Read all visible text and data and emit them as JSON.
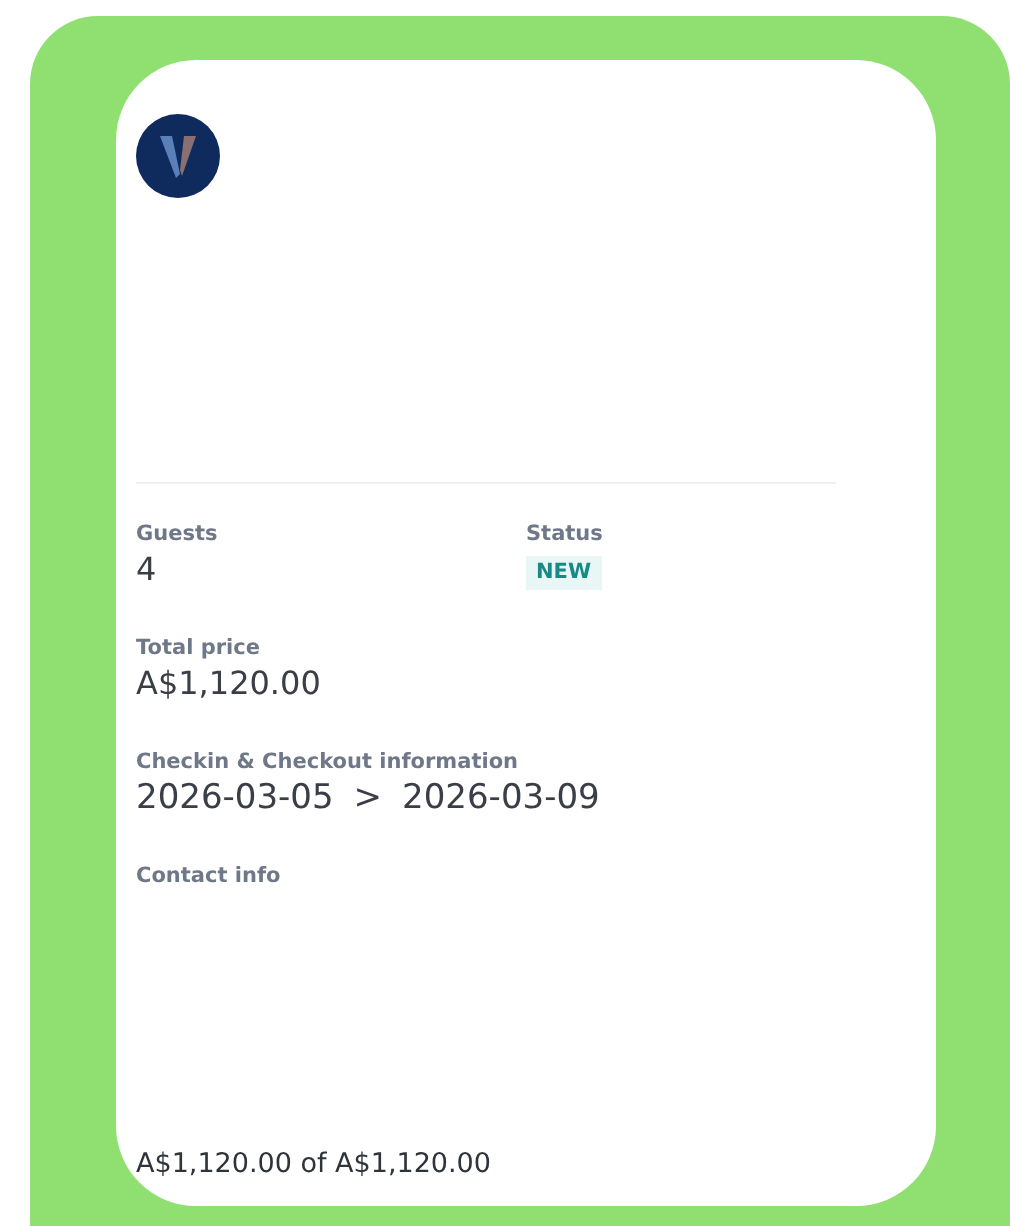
{
  "guests": {
    "label": "Guests",
    "value": "4"
  },
  "status": {
    "label": "Status",
    "badge": "NEW"
  },
  "total_price": {
    "label": "Total price",
    "value": "A$1,120.00"
  },
  "dates": {
    "label": "Checkin & Checkout information",
    "checkin": "2026-03-05",
    "separator": ">",
    "checkout": "2026-03-09"
  },
  "contact": {
    "label": "Contact info"
  },
  "paid_summary": "A$1,120.00 of A$1,120.00"
}
